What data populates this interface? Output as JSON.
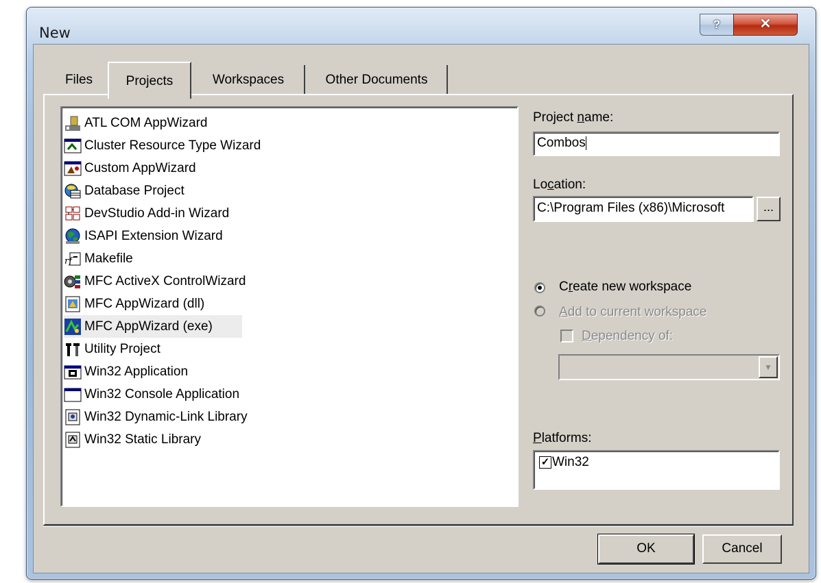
{
  "window": {
    "title": "New",
    "help_label": "?",
    "close_label": "✕"
  },
  "tabs": [
    {
      "label": "Files"
    },
    {
      "label": "Projects"
    },
    {
      "label": "Workspaces"
    },
    {
      "label": "Other Documents"
    }
  ],
  "active_tab": "Projects",
  "project_types": [
    {
      "label": "ATL COM AppWizard",
      "icon": "atl-com-icon"
    },
    {
      "label": "Cluster Resource Type Wizard",
      "icon": "cluster-icon"
    },
    {
      "label": "Custom AppWizard",
      "icon": "custom-wizard-icon"
    },
    {
      "label": "Database Project",
      "icon": "database-icon"
    },
    {
      "label": "DevStudio Add-in Wizard",
      "icon": "addin-icon"
    },
    {
      "label": "ISAPI Extension Wizard",
      "icon": "globe-icon"
    },
    {
      "label": "Makefile",
      "icon": "makefile-icon"
    },
    {
      "label": "MFC ActiveX ControlWizard",
      "icon": "activex-icon"
    },
    {
      "label": "MFC AppWizard (dll)",
      "icon": "mfc-dll-icon"
    },
    {
      "label": "MFC AppWizard (exe)",
      "icon": "mfc-exe-icon"
    },
    {
      "label": "Utility Project",
      "icon": "tools-icon"
    },
    {
      "label": "Win32 Application",
      "icon": "win32-app-icon"
    },
    {
      "label": "Win32 Console Application",
      "icon": "console-icon"
    },
    {
      "label": "Win32 Dynamic-Link Library",
      "icon": "dll-icon"
    },
    {
      "label": "Win32 Static Library",
      "icon": "lib-icon"
    }
  ],
  "selected_project": "MFC AppWizard (exe)",
  "project_name": {
    "label_pre": "Project ",
    "label_accel": "n",
    "label_post": "ame:",
    "value": "Combos"
  },
  "location": {
    "label_pre": "Lo",
    "label_accel": "c",
    "label_post": "ation:",
    "value": "C:\\Program Files (x86)\\Microsoft",
    "browse_label": "..."
  },
  "workspace": {
    "create_pre": "C",
    "create_accel": "r",
    "create_post": "eate new workspace",
    "add_accel": "A",
    "add_post": "dd to current workspace",
    "dependency_accel": "D",
    "dependency_post": "ependency of:",
    "dependency_value": ""
  },
  "platforms": {
    "label_accel": "P",
    "label_post": "latforms:",
    "items": [
      {
        "label": "Win32",
        "checked": true
      }
    ]
  },
  "buttons": {
    "ok": "OK",
    "cancel": "Cancel"
  }
}
